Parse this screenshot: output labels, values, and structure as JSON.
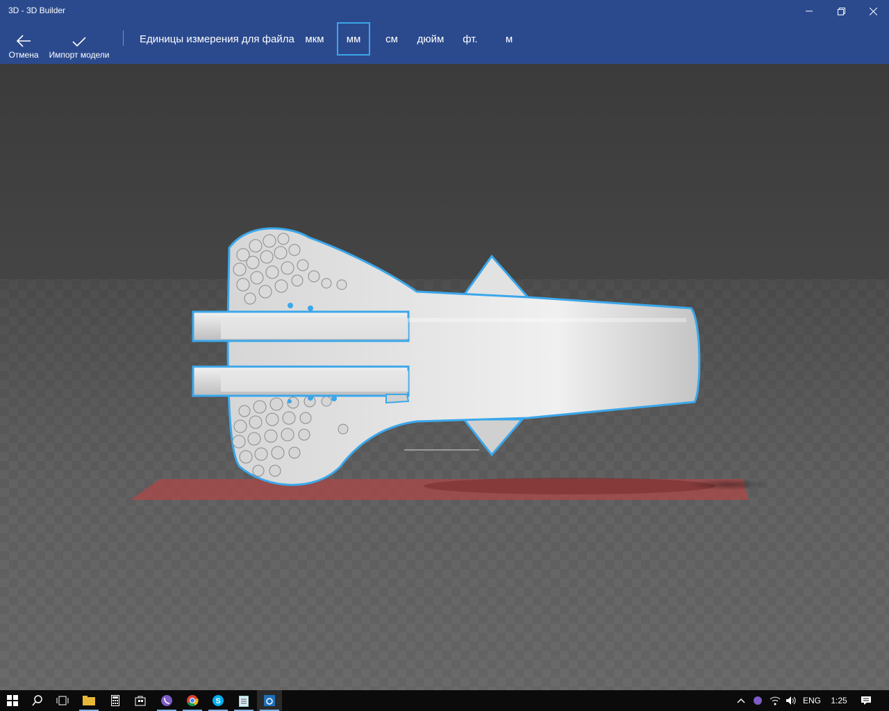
{
  "window": {
    "title": "3D - 3D Builder"
  },
  "toolbar": {
    "cancel_label": "Отмена",
    "import_label": "Импорт модели"
  },
  "units": {
    "label": "Единицы измерения для файла",
    "options": [
      "мкм",
      "мм",
      "см",
      "дюйм",
      "фт.",
      "м"
    ],
    "selected": "мм"
  },
  "taskbar": {
    "apps": [
      "start-icon",
      "search-icon",
      "task-view-icon",
      "file-explorer-icon",
      "calculator-icon",
      "store-icon",
      "viber-icon",
      "chrome-icon",
      "skype-icon",
      "notepad-icon",
      "3d-builder-icon"
    ],
    "tray": {
      "language": "ENG",
      "time": "1:25"
    }
  },
  "colors": {
    "accent": "#2b4a8e",
    "selection": "#3ba7ea",
    "floor_marker": "#a84848"
  }
}
